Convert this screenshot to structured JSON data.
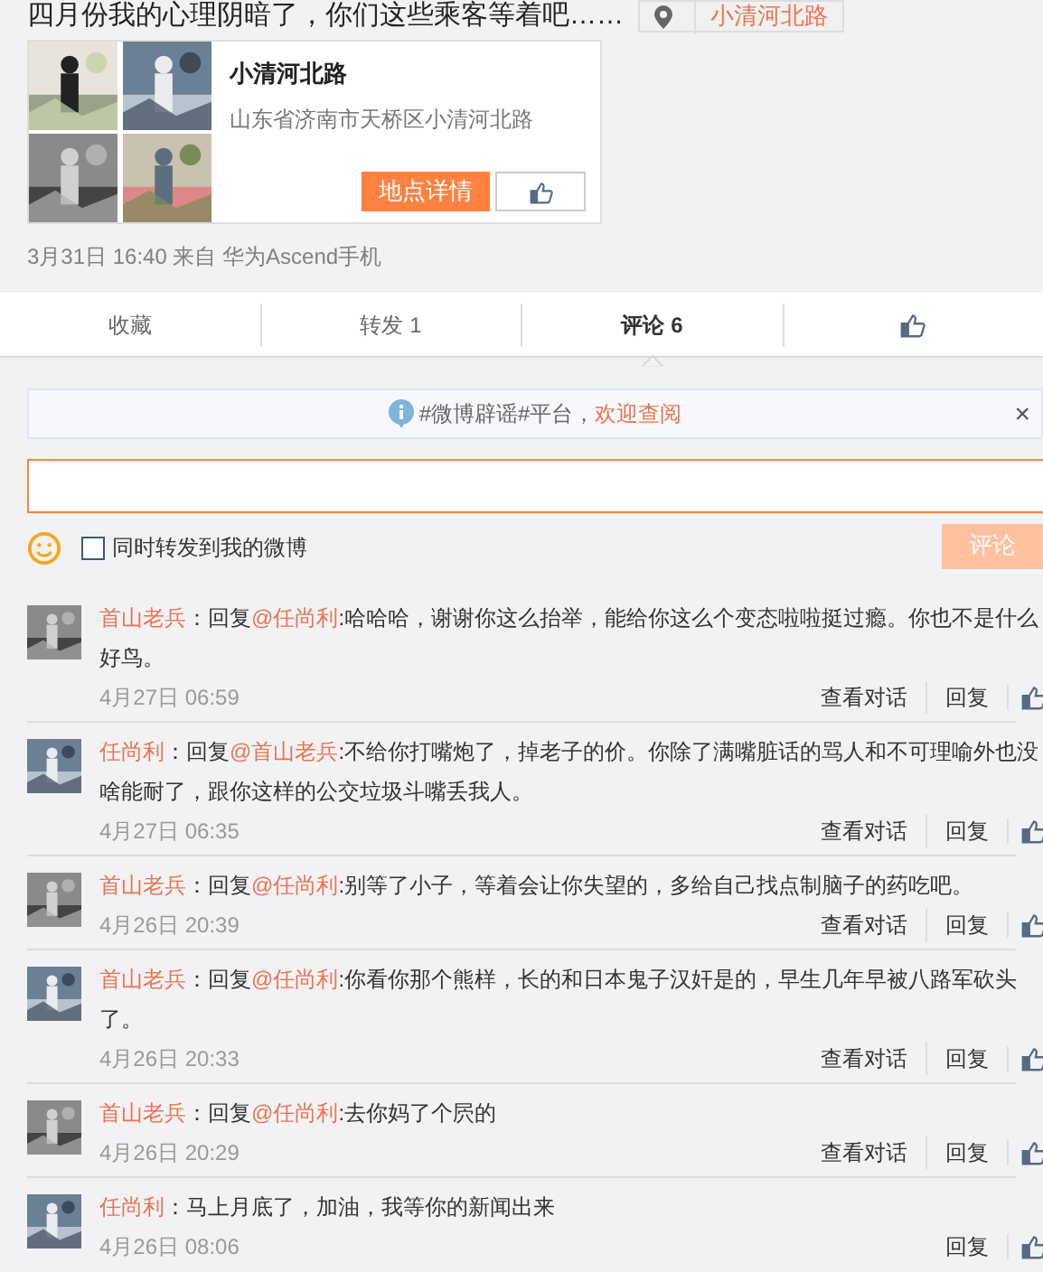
{
  "post": {
    "text": "四月份我的心理阴暗了，你们这些乘客等着吧……",
    "location": "小清河北路"
  },
  "place_card": {
    "name": "小清河北路",
    "address": "山东省济南市天桥区小清河北路",
    "detail_button": "地点详情"
  },
  "meta": "3月31日 16:40 来自 华为Ascend手机",
  "tabs": [
    {
      "kind": "text",
      "label": "收藏",
      "selected": false
    },
    {
      "kind": "text",
      "label": "转发 1",
      "selected": false
    },
    {
      "kind": "text",
      "label": "评论 6",
      "selected": true
    },
    {
      "kind": "like",
      "selected": false
    }
  ],
  "notice": {
    "text": "#微博辟谣#平台，",
    "link": "欢迎查阅",
    "close": "×"
  },
  "compose": {
    "checkbox_label": "同时转发到我的微博",
    "checked": false,
    "submit": "评论"
  },
  "comments": [
    {
      "author": "首山老兵",
      "prefix": "：回复",
      "mention": "@任尚利",
      "text": ":哈哈哈，谢谢你这么抬举，能给你这么个变态啦啦挺过瘾。你也不是什么好鸟。",
      "time": "4月27日 06:59",
      "actions": [
        "查看对话",
        "回复"
      ]
    },
    {
      "author": "任尚利",
      "prefix": "：回复",
      "mention": "@首山老兵",
      "text": ":不给你打嘴炮了，掉老子的价。你除了满嘴脏话的骂人和不可理喻外也没啥能耐了，跟你这样的公交垃圾斗嘴丢我人。",
      "time": "4月27日 06:35",
      "actions": [
        "查看对话",
        "回复"
      ]
    },
    {
      "author": "首山老兵",
      "prefix": "：回复",
      "mention": "@任尚利",
      "text": ":别等了小子，等着会让你失望的，多给自己找点制脑子的药吃吧。",
      "time": "4月26日 20:39",
      "actions": [
        "查看对话",
        "回复"
      ]
    },
    {
      "author": "首山老兵",
      "prefix": "：回复",
      "mention": "@任尚利",
      "text": ":你看你那个熊样，长的和日本鬼子汉奸是的，早生几年早被八路军砍头了。",
      "time": "4月26日 20:33",
      "actions": [
        "查看对话",
        "回复"
      ]
    },
    {
      "author": "首山老兵",
      "prefix": "：回复",
      "mention": "@任尚利",
      "text": ":去你妈了个屄的",
      "time": "4月26日 20:29",
      "actions": [
        "查看对话",
        "回复"
      ]
    },
    {
      "author": "任尚利",
      "prefix": "：",
      "text": "马上月底了，加油，我等你的新闻出来",
      "time": "4月26日 08:06",
      "actions": [
        "回复"
      ]
    }
  ]
}
